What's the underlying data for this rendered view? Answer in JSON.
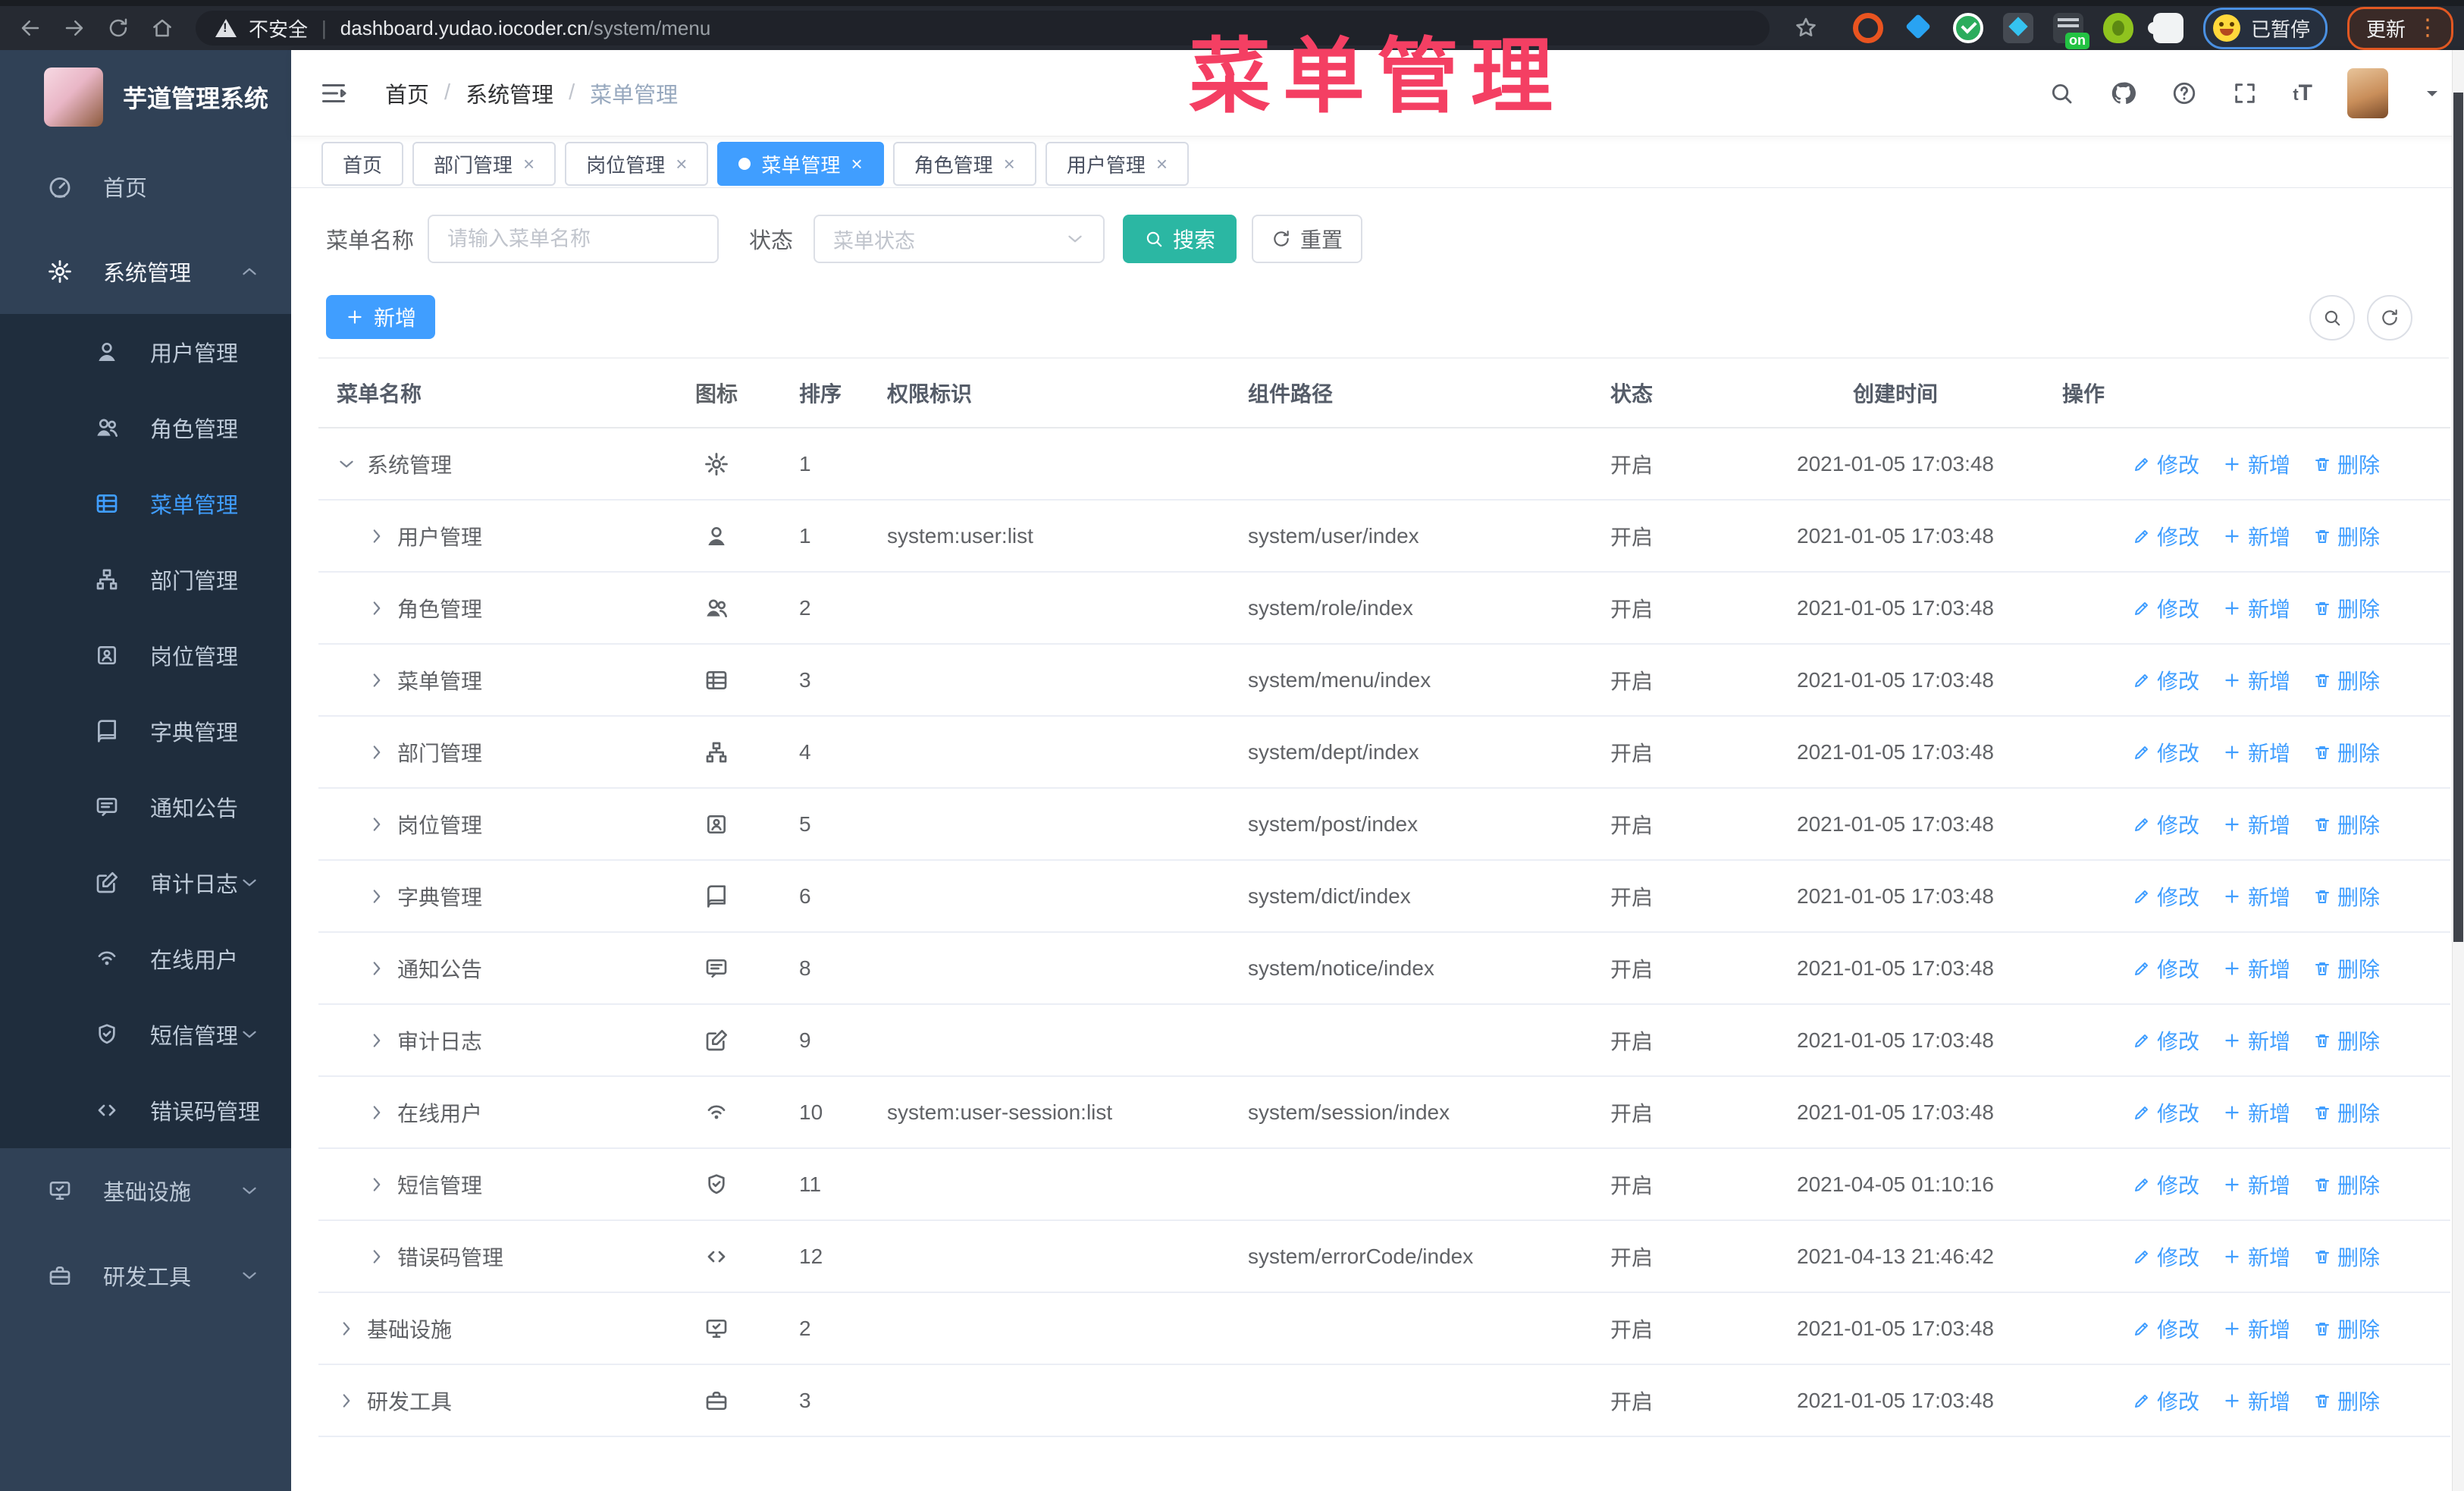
{
  "browser": {
    "security_label": "不安全",
    "url_host": "dashboard.yudao.iocoder.cn",
    "url_path": "/system/menu",
    "on_badge": "on",
    "extensions_paused_label": "已暂停",
    "update_label": "更新"
  },
  "annotation": {
    "text": "菜单管理",
    "color": "#f43f63"
  },
  "sidebar": {
    "logo_title": "芋道管理系统",
    "items": [
      {
        "label": "首页",
        "icon": "dashboard",
        "level": 0,
        "active": false,
        "caret": ""
      },
      {
        "label": "系统管理",
        "icon": "gear",
        "level": 0,
        "active": false,
        "caret": "up",
        "open": true
      },
      {
        "label": "用户管理",
        "icon": "user",
        "level": 1,
        "active": false,
        "caret": ""
      },
      {
        "label": "角色管理",
        "icon": "users",
        "level": 1,
        "active": false,
        "caret": ""
      },
      {
        "label": "菜单管理",
        "icon": "menu",
        "level": 1,
        "active": true,
        "caret": ""
      },
      {
        "label": "部门管理",
        "icon": "tree",
        "level": 1,
        "active": false,
        "caret": ""
      },
      {
        "label": "岗位管理",
        "icon": "post",
        "level": 1,
        "active": false,
        "caret": ""
      },
      {
        "label": "字典管理",
        "icon": "dict",
        "level": 1,
        "active": false,
        "caret": ""
      },
      {
        "label": "通知公告",
        "icon": "message",
        "level": 1,
        "active": false,
        "caret": ""
      },
      {
        "label": "审计日志",
        "icon": "log",
        "level": 1,
        "active": false,
        "caret": "down"
      },
      {
        "label": "在线用户",
        "icon": "online",
        "level": 1,
        "active": false,
        "caret": ""
      },
      {
        "label": "短信管理",
        "icon": "sms",
        "level": 1,
        "active": false,
        "caret": "down"
      },
      {
        "label": "错误码管理",
        "icon": "code",
        "level": 1,
        "active": false,
        "caret": ""
      },
      {
        "label": "基础设施",
        "icon": "monitor",
        "level": 0,
        "active": false,
        "caret": "down"
      },
      {
        "label": "研发工具",
        "icon": "tool",
        "level": 0,
        "active": false,
        "caret": "down"
      }
    ]
  },
  "topbar": {
    "breadcrumbs": [
      "首页",
      "系统管理",
      "菜单管理"
    ]
  },
  "tabs": [
    {
      "label": "首页",
      "closable": false,
      "active": false
    },
    {
      "label": "部门管理",
      "closable": true,
      "active": false
    },
    {
      "label": "岗位管理",
      "closable": true,
      "active": false
    },
    {
      "label": "菜单管理",
      "closable": true,
      "active": true
    },
    {
      "label": "角色管理",
      "closable": true,
      "active": false
    },
    {
      "label": "用户管理",
      "closable": true,
      "active": false
    }
  ],
  "filters": {
    "name_label": "菜单名称",
    "name_placeholder": "请输入菜单名称",
    "status_label": "状态",
    "status_placeholder": "菜单状态",
    "search_label": "搜索",
    "reset_label": "重置"
  },
  "toolbar": {
    "add_label": "新增"
  },
  "table": {
    "columns": [
      "菜单名称",
      "图标",
      "排序",
      "权限标识",
      "组件路径",
      "状态",
      "创建时间",
      "操作"
    ],
    "action_labels": [
      "修改",
      "新增",
      "删除"
    ],
    "rows": [
      {
        "name": "系统管理",
        "level": 0,
        "caret": "down",
        "icon": "gear",
        "sort": "1",
        "perms": "",
        "path": "",
        "status": "开启",
        "created": "2021-01-05 17:03:48"
      },
      {
        "name": "用户管理",
        "level": 1,
        "caret": "right",
        "icon": "user",
        "sort": "1",
        "perms": "system:user:list",
        "path": "system/user/index",
        "status": "开启",
        "created": "2021-01-05 17:03:48"
      },
      {
        "name": "角色管理",
        "level": 1,
        "caret": "right",
        "icon": "users",
        "sort": "2",
        "perms": "",
        "path": "system/role/index",
        "status": "开启",
        "created": "2021-01-05 17:03:48"
      },
      {
        "name": "菜单管理",
        "level": 1,
        "caret": "right",
        "icon": "menu",
        "sort": "3",
        "perms": "",
        "path": "system/menu/index",
        "status": "开启",
        "created": "2021-01-05 17:03:48"
      },
      {
        "name": "部门管理",
        "level": 1,
        "caret": "right",
        "icon": "tree",
        "sort": "4",
        "perms": "",
        "path": "system/dept/index",
        "status": "开启",
        "created": "2021-01-05 17:03:48"
      },
      {
        "name": "岗位管理",
        "level": 1,
        "caret": "right",
        "icon": "post",
        "sort": "5",
        "perms": "",
        "path": "system/post/index",
        "status": "开启",
        "created": "2021-01-05 17:03:48"
      },
      {
        "name": "字典管理",
        "level": 1,
        "caret": "right",
        "icon": "dict",
        "sort": "6",
        "perms": "",
        "path": "system/dict/index",
        "status": "开启",
        "created": "2021-01-05 17:03:48"
      },
      {
        "name": "通知公告",
        "level": 1,
        "caret": "right",
        "icon": "message",
        "sort": "8",
        "perms": "",
        "path": "system/notice/index",
        "status": "开启",
        "created": "2021-01-05 17:03:48"
      },
      {
        "name": "审计日志",
        "level": 1,
        "caret": "right",
        "icon": "log",
        "sort": "9",
        "perms": "",
        "path": "",
        "status": "开启",
        "created": "2021-01-05 17:03:48"
      },
      {
        "name": "在线用户",
        "level": 1,
        "caret": "right",
        "icon": "online",
        "sort": "10",
        "perms": "system:user-session:list",
        "path": "system/session/index",
        "status": "开启",
        "created": "2021-01-05 17:03:48"
      },
      {
        "name": "短信管理",
        "level": 1,
        "caret": "right",
        "icon": "sms",
        "sort": "11",
        "perms": "",
        "path": "",
        "status": "开启",
        "created": "2021-04-05 01:10:16"
      },
      {
        "name": "错误码管理",
        "level": 1,
        "caret": "right",
        "icon": "code",
        "sort": "12",
        "perms": "",
        "path": "system/errorCode/index",
        "status": "开启",
        "created": "2021-04-13 21:46:42"
      },
      {
        "name": "基础设施",
        "level": 0,
        "caret": "right",
        "icon": "monitor",
        "sort": "2",
        "perms": "",
        "path": "",
        "status": "开启",
        "created": "2021-01-05 17:03:48"
      },
      {
        "name": "研发工具",
        "level": 0,
        "caret": "right",
        "icon": "tool",
        "sort": "3",
        "perms": "",
        "path": "",
        "status": "开启",
        "created": "2021-01-05 17:03:48"
      }
    ]
  },
  "colors": {
    "accent": "#409eff",
    "teal": "#2bb7a3",
    "sidebar_bg": "#304156",
    "submenu_bg": "#1f2d3d"
  }
}
